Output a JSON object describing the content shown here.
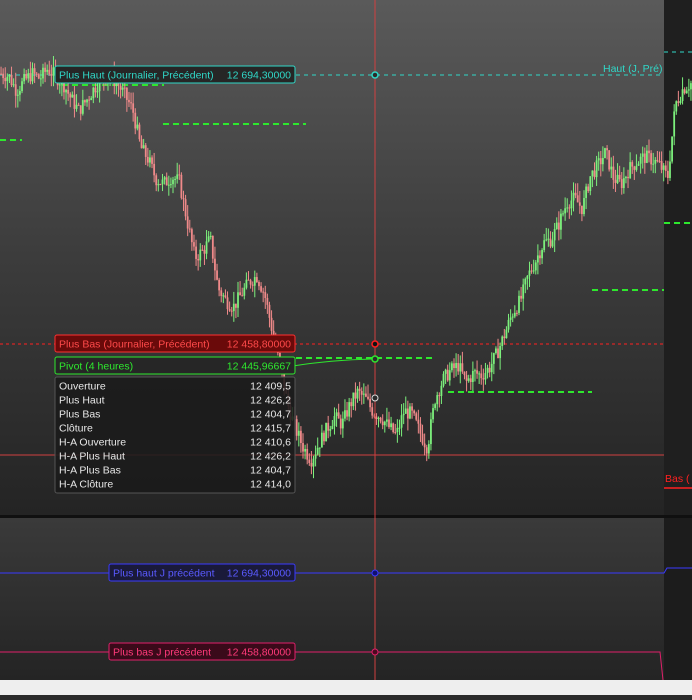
{
  "colors": {
    "bull": "#7cf07c",
    "bear": "#f08a8a",
    "cyan": "#30d8c8",
    "red_line": "#ff2020",
    "green_dash": "#2ee82e",
    "blue": "#3a3aff",
    "pink": "#e0206a"
  },
  "labels": {
    "haut_prev": {
      "text": "Plus Haut (Journalier, Précédent)",
      "value": "12 694,30000"
    },
    "bas_prev": {
      "text": "Plus Bas (Journalier, Précédent)",
      "value": "12 458,80000"
    },
    "pivot": {
      "text": "Pivot (4 heures)",
      "value": "12 445,96667"
    },
    "haut_right": "Haut (J, Pré)",
    "bas_right": "Bas (",
    "panel_haut": {
      "text": "Plus haut J précédent",
      "value": "12 694,30000"
    },
    "panel_bas": {
      "text": "Plus bas J précédent",
      "value": "12 458,80000"
    }
  },
  "info_rows": [
    {
      "label": "Ouverture",
      "value": "12 409,5"
    },
    {
      "label": "Plus Haut",
      "value": "12 426,2"
    },
    {
      "label": "Plus Bas",
      "value": "12 404,7"
    },
    {
      "label": "Clôture",
      "value": "12 415,7"
    },
    {
      "label": "H-A Ouverture",
      "value": "12 410,6"
    },
    {
      "label": "H-A Plus Haut",
      "value": "12 426,2"
    },
    {
      "label": "H-A Plus Bas",
      "value": "12 404,7"
    },
    {
      "label": "H-A Clôture",
      "value": "12 414,0"
    }
  ],
  "chart_data": {
    "type": "candlestick",
    "levels": {
      "prev_day_high": 12694.3,
      "prev_day_low": 12458.8,
      "pivot_4h": 12445.96667
    },
    "ylim": [
      12330,
      12750
    ],
    "price_path": [
      12690,
      12688,
      12676,
      12684,
      12690,
      12686,
      12694,
      12688,
      12682,
      12670,
      12660,
      12668,
      12678,
      12686,
      12688,
      12682,
      12672,
      12660,
      12630,
      12620,
      12604,
      12600,
      12606,
      12602,
      12570,
      12540,
      12545,
      12555,
      12515,
      12505,
      12500,
      12510,
      12520,
      12525,
      12510,
      12480,
      12450,
      12420,
      12400,
      12385,
      12375,
      12388,
      12400,
      12410,
      12404,
      12420,
      12430,
      12425,
      12414,
      12410,
      12402,
      12395,
      12415,
      12412,
      12398,
      12385,
      12425,
      12440,
      12448,
      12452,
      12438,
      12446,
      12444,
      12450,
      12462,
      12478,
      12495,
      12505,
      12525,
      12538,
      12552,
      12555,
      12568,
      12585,
      12588,
      12580,
      12606,
      12615,
      12626,
      12605,
      12600,
      12612,
      12618,
      12622,
      12620,
      12615,
      12605,
      12665,
      12678,
      12682
    ]
  }
}
